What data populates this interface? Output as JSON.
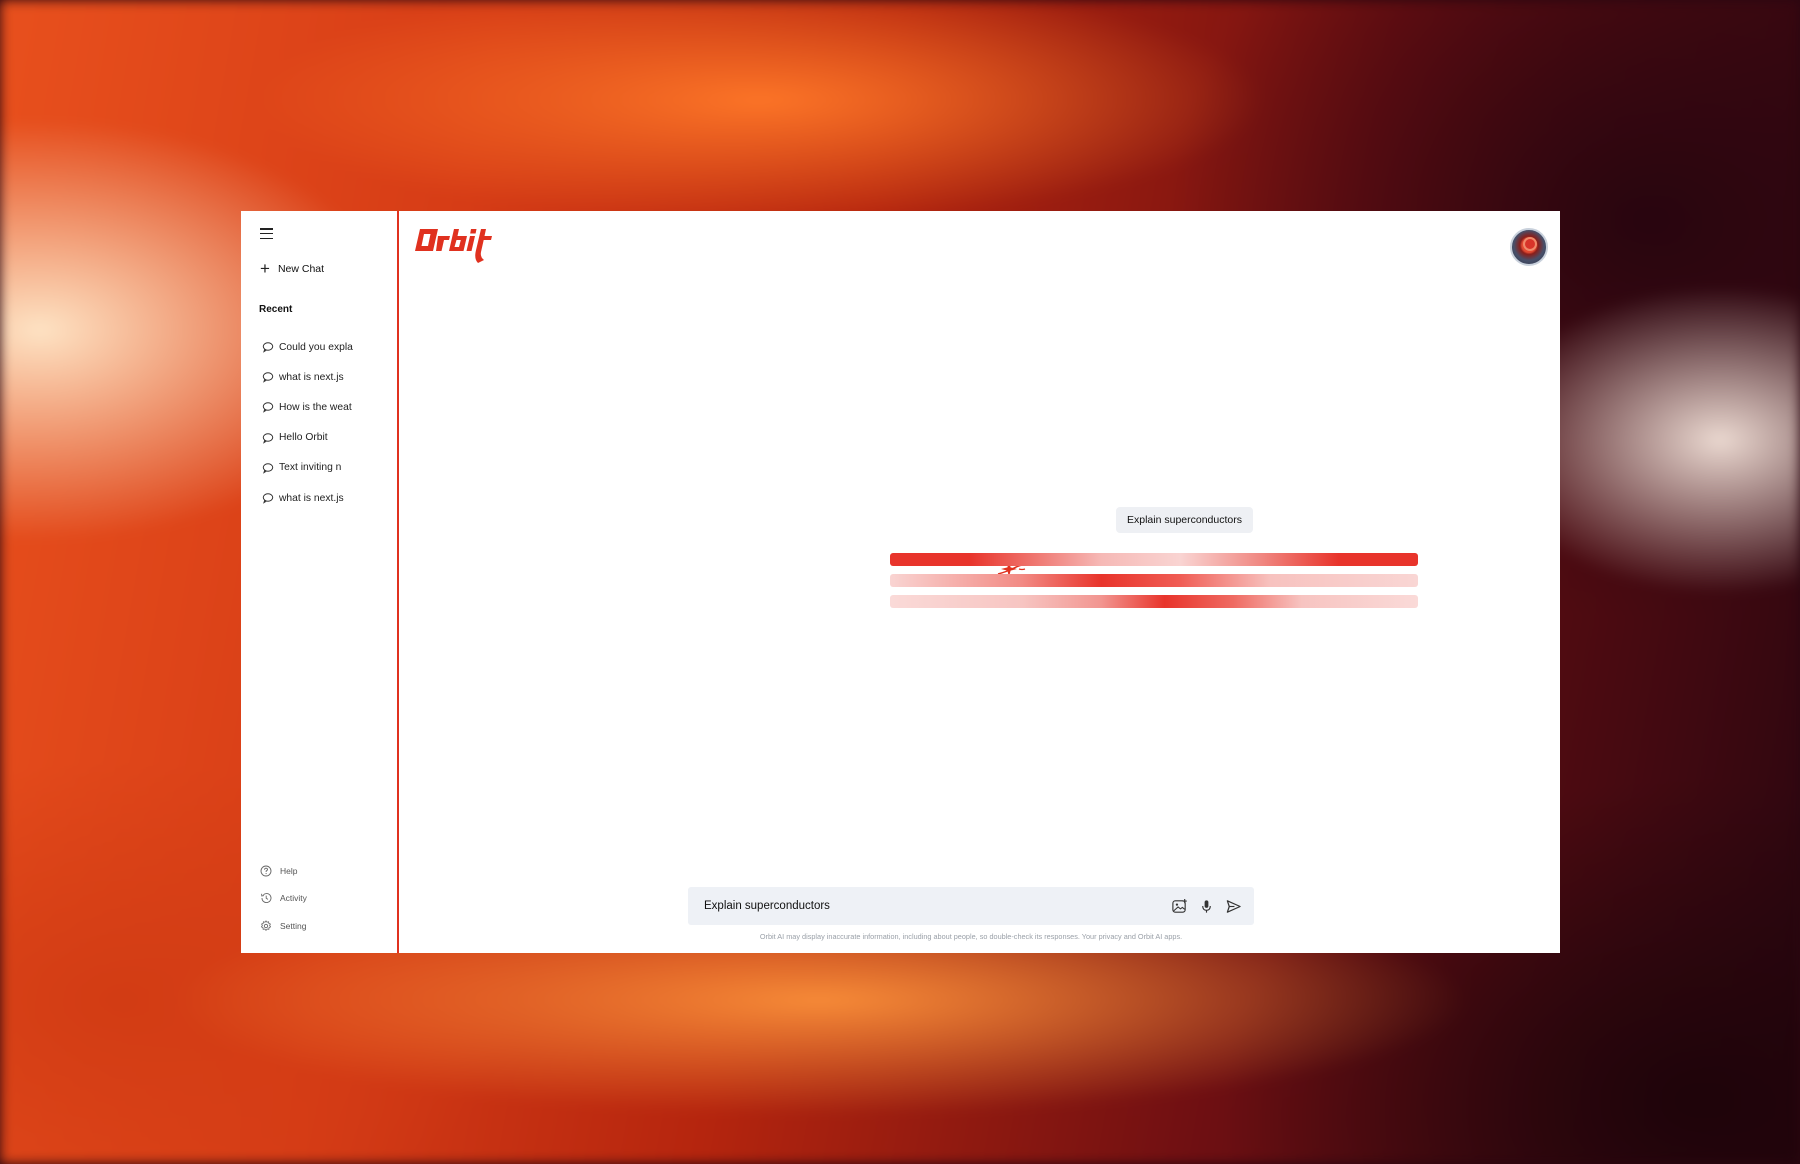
{
  "app": {
    "name": "Orbit"
  },
  "sidebar": {
    "new_chat_label": "New Chat",
    "recent_heading": "Recent",
    "recent_items": [
      {
        "label": "Could you expla"
      },
      {
        "label": "what is next.js"
      },
      {
        "label": "How is the weat"
      },
      {
        "label": "Hello Orbit"
      },
      {
        "label": "Text inviting n"
      },
      {
        "label": "what is next.js"
      }
    ],
    "bottom_items": [
      {
        "label": "Help",
        "icon": "help-icon"
      },
      {
        "label": "Activity",
        "icon": "activity-icon"
      },
      {
        "label": "Setting",
        "icon": "settings-icon"
      }
    ]
  },
  "conversation": {
    "user_message": "Explain superconductors",
    "response_state": "loading"
  },
  "composer": {
    "value": "Explain superconductors",
    "icons": [
      "image-upload-icon",
      "microphone-icon",
      "send-icon"
    ]
  },
  "disclaimer": "Orbit AI may display inaccurate information, including about people, so double-check its responses. Your privacy and Orbit AI apps.",
  "colors": {
    "accent": "#e0311f",
    "input_bg": "#eef1f6",
    "bubble_bg": "#eef0f4"
  }
}
